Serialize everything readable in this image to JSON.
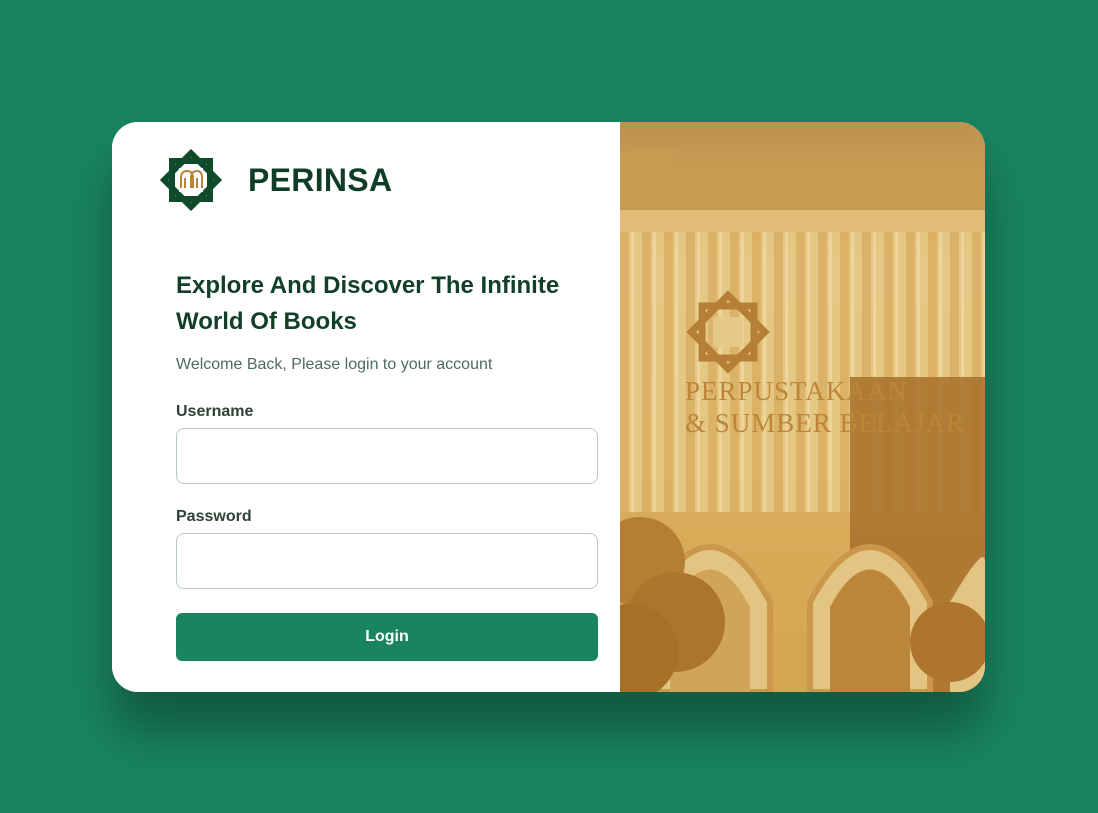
{
  "brand": {
    "name": "PERINSA",
    "logo_icon": "perinsa-star-logo-icon",
    "logo_colors": {
      "primary": "#0f4a2b",
      "accent": "#b7863a"
    }
  },
  "login": {
    "headline": "Explore And Discover The Infinite World Of Books",
    "subtitle": "Welcome Back, Please login to your account",
    "username_label": "Username",
    "username_value": "",
    "username_placeholder": "",
    "password_label": "Password",
    "password_value": "",
    "password_placeholder": "",
    "button_label": "Login"
  },
  "hero_image": {
    "description_icon": "library-building-photo",
    "sign_line1": "PERPUSTAKAAN",
    "sign_line2": "& SUMBER BELAJAR",
    "tint_color": "#d4a654"
  },
  "colors": {
    "background": "#198460",
    "primary": "#198460",
    "heading": "#123f27",
    "card": "#ffffff"
  }
}
